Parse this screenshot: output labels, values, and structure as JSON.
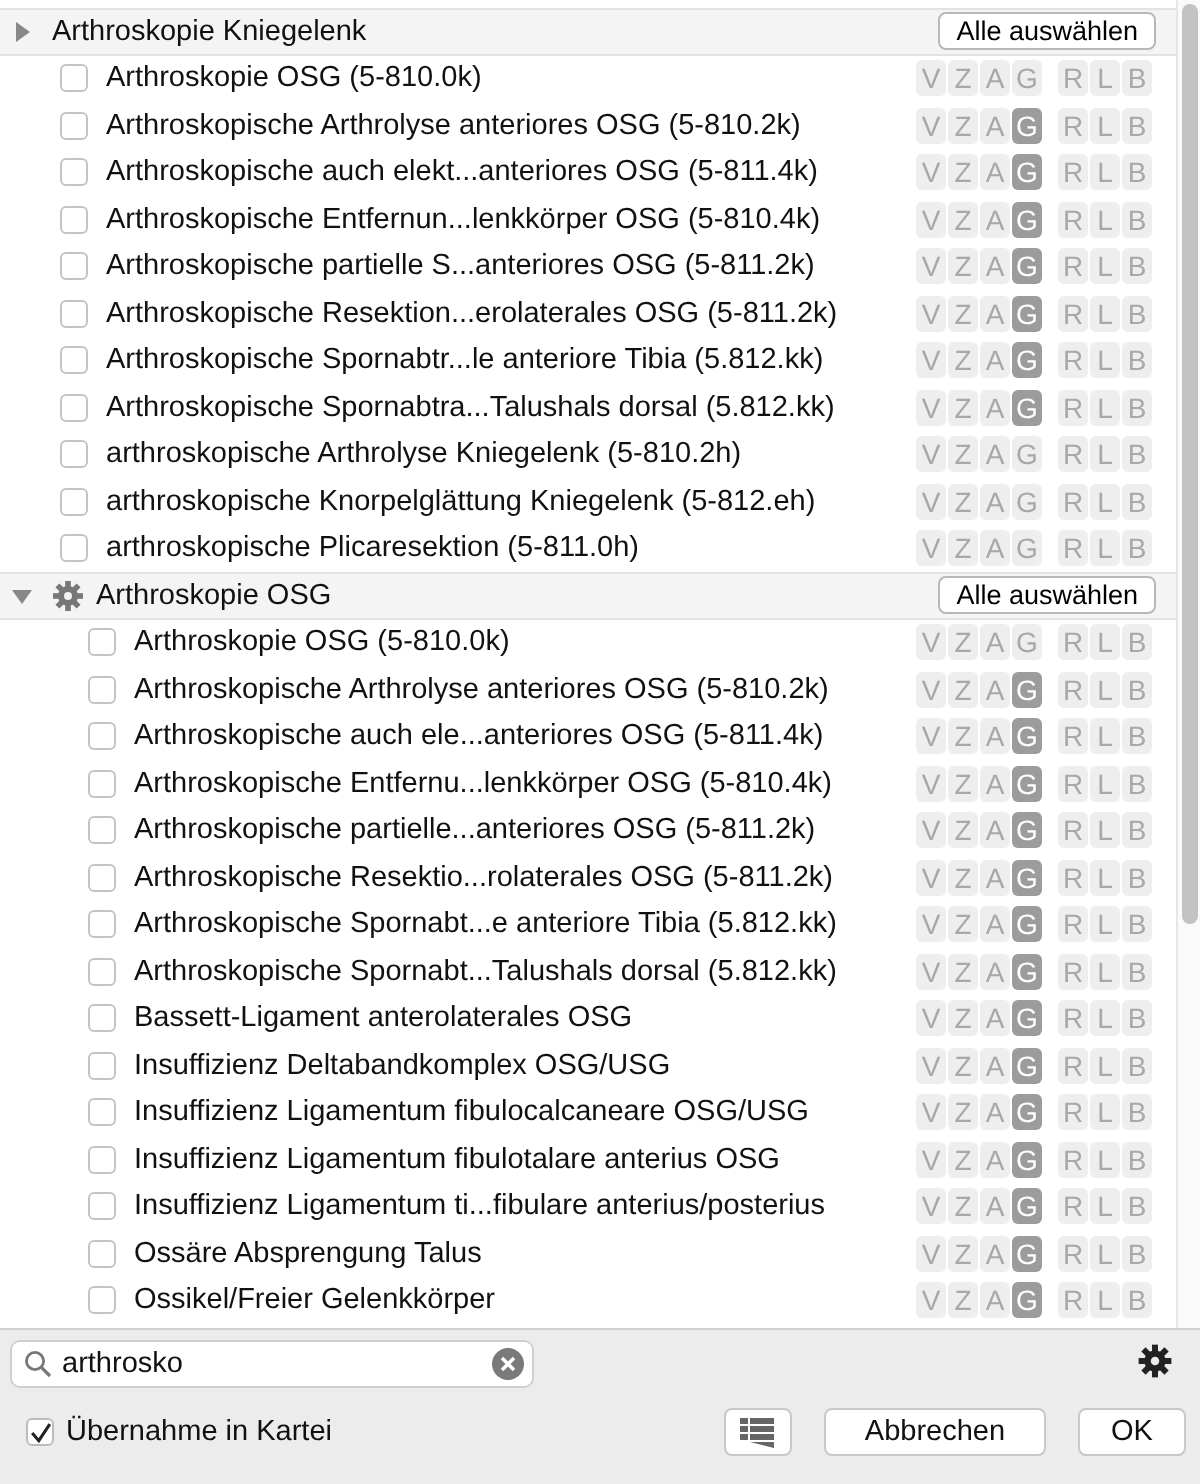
{
  "groups": [
    {
      "title": "Arthroskopie Kniegelenk",
      "expanded": false,
      "has_gear": false,
      "button": "Alle auswählen",
      "items": [
        {
          "label": "Arthroskopie OSG (5-810.0k)",
          "checked": false,
          "codes": [
            {
              "t": "V",
              "on": false
            },
            {
              "t": "Z",
              "on": false
            },
            {
              "t": "A",
              "on": false
            },
            {
              "t": "G",
              "on": false
            }
          ],
          "sides": [
            "R",
            "L",
            "B"
          ]
        },
        {
          "label": "Arthroskopische Arthrolyse anteriores OSG (5-810.2k)",
          "checked": false,
          "codes": [
            {
              "t": "V",
              "on": false
            },
            {
              "t": "Z",
              "on": false
            },
            {
              "t": "A",
              "on": false
            },
            {
              "t": "G",
              "on": true
            }
          ],
          "sides": [
            "R",
            "L",
            "B"
          ]
        },
        {
          "label": "Arthroskopische auch elekt...anteriores OSG (5-811.4k)",
          "checked": false,
          "codes": [
            {
              "t": "V",
              "on": false
            },
            {
              "t": "Z",
              "on": false
            },
            {
              "t": "A",
              "on": false
            },
            {
              "t": "G",
              "on": true
            }
          ],
          "sides": [
            "R",
            "L",
            "B"
          ]
        },
        {
          "label": "Arthroskopische Entfernun...lenkkörper OSG (5-810.4k)",
          "checked": false,
          "codes": [
            {
              "t": "V",
              "on": false
            },
            {
              "t": "Z",
              "on": false
            },
            {
              "t": "A",
              "on": false
            },
            {
              "t": "G",
              "on": true
            }
          ],
          "sides": [
            "R",
            "L",
            "B"
          ]
        },
        {
          "label": "Arthroskopische partielle S...anteriores OSG (5-811.2k)",
          "checked": false,
          "codes": [
            {
              "t": "V",
              "on": false
            },
            {
              "t": "Z",
              "on": false
            },
            {
              "t": "A",
              "on": false
            },
            {
              "t": "G",
              "on": true
            }
          ],
          "sides": [
            "R",
            "L",
            "B"
          ]
        },
        {
          "label": "Arthroskopische Resektion...erolaterales OSG (5-811.2k)",
          "checked": false,
          "codes": [
            {
              "t": "V",
              "on": false
            },
            {
              "t": "Z",
              "on": false
            },
            {
              "t": "A",
              "on": false
            },
            {
              "t": "G",
              "on": true
            }
          ],
          "sides": [
            "R",
            "L",
            "B"
          ]
        },
        {
          "label": "Arthroskopische Spornabtr...le anteriore Tibia (5.812.kk)",
          "checked": false,
          "codes": [
            {
              "t": "V",
              "on": false
            },
            {
              "t": "Z",
              "on": false
            },
            {
              "t": "A",
              "on": false
            },
            {
              "t": "G",
              "on": true
            }
          ],
          "sides": [
            "R",
            "L",
            "B"
          ]
        },
        {
          "label": "Arthroskopische Spornabtra...Talushals dorsal (5.812.kk)",
          "checked": false,
          "codes": [
            {
              "t": "V",
              "on": false
            },
            {
              "t": "Z",
              "on": false
            },
            {
              "t": "A",
              "on": false
            },
            {
              "t": "G",
              "on": true
            }
          ],
          "sides": [
            "R",
            "L",
            "B"
          ]
        },
        {
          "label": "arthroskopische Arthrolyse Kniegelenk (5-810.2h)",
          "checked": false,
          "codes": [
            {
              "t": "V",
              "on": false
            },
            {
              "t": "Z",
              "on": false
            },
            {
              "t": "A",
              "on": false
            },
            {
              "t": "G",
              "on": false
            }
          ],
          "sides": [
            "R",
            "L",
            "B"
          ]
        },
        {
          "label": "arthroskopische Knorpelglättung Kniegelenk (5-812.eh)",
          "checked": false,
          "codes": [
            {
              "t": "V",
              "on": false
            },
            {
              "t": "Z",
              "on": false
            },
            {
              "t": "A",
              "on": false
            },
            {
              "t": "G",
              "on": false
            }
          ],
          "sides": [
            "R",
            "L",
            "B"
          ]
        },
        {
          "label": "arthroskopische Plicaresektion (5-811.0h)",
          "checked": false,
          "codes": [
            {
              "t": "V",
              "on": false
            },
            {
              "t": "Z",
              "on": false
            },
            {
              "t": "A",
              "on": false
            },
            {
              "t": "G",
              "on": false
            }
          ],
          "sides": [
            "R",
            "L",
            "B"
          ]
        }
      ]
    },
    {
      "title": "Arthroskopie OSG",
      "expanded": true,
      "has_gear": true,
      "button": "Alle auswählen",
      "items": [
        {
          "label": "Arthroskopie OSG (5-810.0k)",
          "checked": false,
          "codes": [
            {
              "t": "V",
              "on": false
            },
            {
              "t": "Z",
              "on": false
            },
            {
              "t": "A",
              "on": false
            },
            {
              "t": "G",
              "on": false
            }
          ],
          "sides": [
            "R",
            "L",
            "B"
          ]
        },
        {
          "label": "Arthroskopische Arthrolyse anteriores OSG (5-810.2k)",
          "checked": false,
          "codes": [
            {
              "t": "V",
              "on": false
            },
            {
              "t": "Z",
              "on": false
            },
            {
              "t": "A",
              "on": false
            },
            {
              "t": "G",
              "on": true
            }
          ],
          "sides": [
            "R",
            "L",
            "B"
          ]
        },
        {
          "label": "Arthroskopische auch ele...anteriores OSG (5-811.4k)",
          "checked": false,
          "codes": [
            {
              "t": "V",
              "on": false
            },
            {
              "t": "Z",
              "on": false
            },
            {
              "t": "A",
              "on": false
            },
            {
              "t": "G",
              "on": true
            }
          ],
          "sides": [
            "R",
            "L",
            "B"
          ]
        },
        {
          "label": "Arthroskopische Entfernu...lenkkörper OSG (5-810.4k)",
          "checked": false,
          "codes": [
            {
              "t": "V",
              "on": false
            },
            {
              "t": "Z",
              "on": false
            },
            {
              "t": "A",
              "on": false
            },
            {
              "t": "G",
              "on": true
            }
          ],
          "sides": [
            "R",
            "L",
            "B"
          ]
        },
        {
          "label": "Arthroskopische partielle...anteriores OSG (5-811.2k)",
          "checked": false,
          "codes": [
            {
              "t": "V",
              "on": false
            },
            {
              "t": "Z",
              "on": false
            },
            {
              "t": "A",
              "on": false
            },
            {
              "t": "G",
              "on": true
            }
          ],
          "sides": [
            "R",
            "L",
            "B"
          ]
        },
        {
          "label": "Arthroskopische Resektio...rolaterales OSG (5-811.2k)",
          "checked": false,
          "codes": [
            {
              "t": "V",
              "on": false
            },
            {
              "t": "Z",
              "on": false
            },
            {
              "t": "A",
              "on": false
            },
            {
              "t": "G",
              "on": true
            }
          ],
          "sides": [
            "R",
            "L",
            "B"
          ]
        },
        {
          "label": "Arthroskopische Spornabt...e anteriore Tibia (5.812.kk)",
          "checked": false,
          "codes": [
            {
              "t": "V",
              "on": false
            },
            {
              "t": "Z",
              "on": false
            },
            {
              "t": "A",
              "on": false
            },
            {
              "t": "G",
              "on": true
            }
          ],
          "sides": [
            "R",
            "L",
            "B"
          ]
        },
        {
          "label": "Arthroskopische Spornabt...Talushals dorsal (5.812.kk)",
          "checked": false,
          "codes": [
            {
              "t": "V",
              "on": false
            },
            {
              "t": "Z",
              "on": false
            },
            {
              "t": "A",
              "on": false
            },
            {
              "t": "G",
              "on": true
            }
          ],
          "sides": [
            "R",
            "L",
            "B"
          ]
        },
        {
          "label": "Bassett-Ligament anterolaterales OSG",
          "checked": false,
          "codes": [
            {
              "t": "V",
              "on": false
            },
            {
              "t": "Z",
              "on": false
            },
            {
              "t": "A",
              "on": false
            },
            {
              "t": "G",
              "on": true
            }
          ],
          "sides": [
            "R",
            "L",
            "B"
          ]
        },
        {
          "label": "Insuffizienz Deltabandkomplex OSG/USG",
          "checked": false,
          "codes": [
            {
              "t": "V",
              "on": false
            },
            {
              "t": "Z",
              "on": false
            },
            {
              "t": "A",
              "on": false
            },
            {
              "t": "G",
              "on": true
            }
          ],
          "sides": [
            "R",
            "L",
            "B"
          ]
        },
        {
          "label": "Insuffizienz Ligamentum fibulocalcaneare OSG/USG",
          "checked": false,
          "codes": [
            {
              "t": "V",
              "on": false
            },
            {
              "t": "Z",
              "on": false
            },
            {
              "t": "A",
              "on": false
            },
            {
              "t": "G",
              "on": true
            }
          ],
          "sides": [
            "R",
            "L",
            "B"
          ]
        },
        {
          "label": "Insuffizienz Ligamentum fibulotalare anterius OSG",
          "checked": false,
          "codes": [
            {
              "t": "V",
              "on": false
            },
            {
              "t": "Z",
              "on": false
            },
            {
              "t": "A",
              "on": false
            },
            {
              "t": "G",
              "on": true
            }
          ],
          "sides": [
            "R",
            "L",
            "B"
          ]
        },
        {
          "label": "Insuffizienz Ligamentum ti...fibulare anterius/posterius",
          "checked": false,
          "codes": [
            {
              "t": "V",
              "on": false
            },
            {
              "t": "Z",
              "on": false
            },
            {
              "t": "A",
              "on": false
            },
            {
              "t": "G",
              "on": true
            }
          ],
          "sides": [
            "R",
            "L",
            "B"
          ]
        },
        {
          "label": "Ossäre Absprengung Talus",
          "checked": false,
          "codes": [
            {
              "t": "V",
              "on": false
            },
            {
              "t": "Z",
              "on": false
            },
            {
              "t": "A",
              "on": false
            },
            {
              "t": "G",
              "on": true
            }
          ],
          "sides": [
            "R",
            "L",
            "B"
          ]
        },
        {
          "label": "Ossikel/Freier Gelenkkörper",
          "checked": false,
          "codes": [
            {
              "t": "V",
              "on": false
            },
            {
              "t": "Z",
              "on": false
            },
            {
              "t": "A",
              "on": false
            },
            {
              "t": "G",
              "on": true
            }
          ],
          "sides": [
            "R",
            "L",
            "B"
          ]
        }
      ]
    }
  ],
  "search": {
    "value": "arthrosko"
  },
  "transfer": {
    "label": "Übernahme in Kartei",
    "checked": true
  },
  "buttons": [
    "Abbrechen",
    "OK"
  ]
}
